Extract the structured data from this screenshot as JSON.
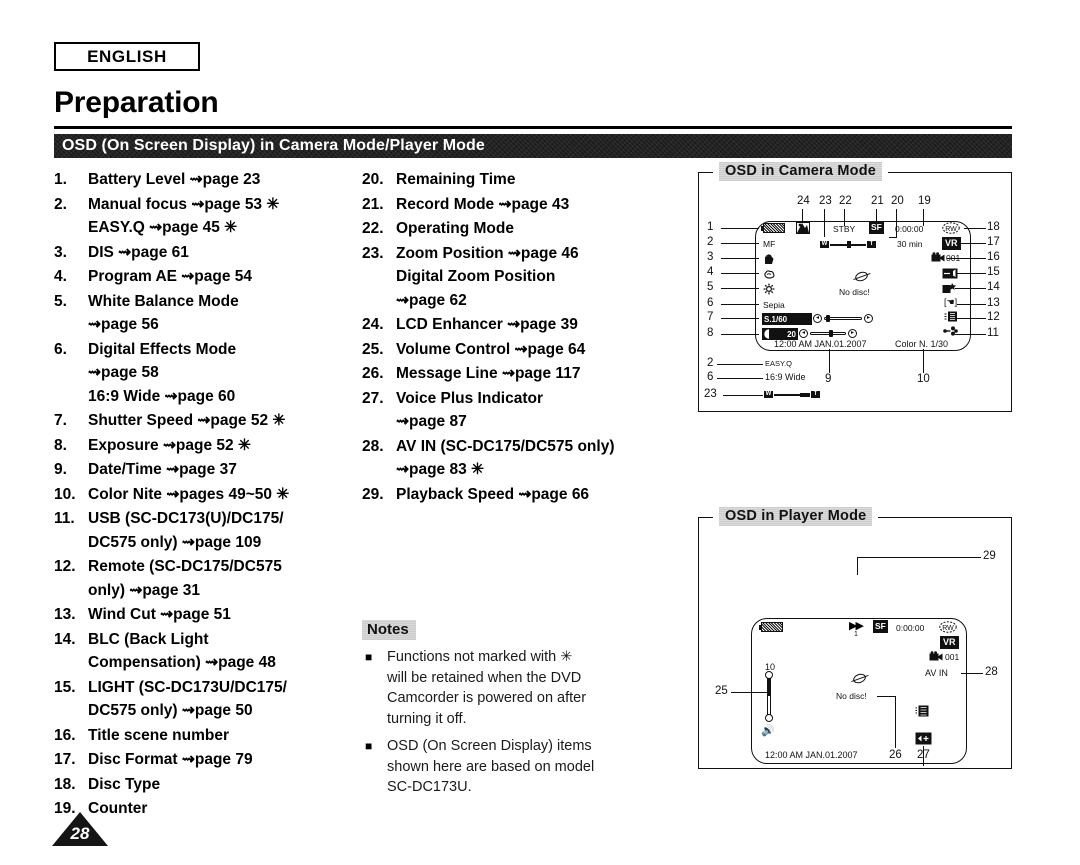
{
  "language_badge": "ENGLISH",
  "chapter_title": "Preparation",
  "section_header": "OSD (On Screen Display) in Camera Mode/Player Mode",
  "page_number": "28",
  "left_list": [
    {
      "num": "1.",
      "text": "Battery Level ⇝page 23"
    },
    {
      "num": "2.",
      "text": "Manual focus ⇝page 53  ✳\nEASY.Q ⇝page 45  ✳"
    },
    {
      "num": "3.",
      "text": "DIS ⇝page 61"
    },
    {
      "num": "4.",
      "text": "Program AE ⇝page 54"
    },
    {
      "num": "5.",
      "text": "White Balance Mode\n⇝page 56"
    },
    {
      "num": "6.",
      "text": "Digital Effects Mode\n⇝page 58\n16:9 Wide ⇝page 60"
    },
    {
      "num": "7.",
      "text": "Shutter Speed ⇝page 52  ✳"
    },
    {
      "num": "8.",
      "text": "Exposure ⇝page 52  ✳"
    },
    {
      "num": "9.",
      "text": "Date/Time ⇝page 37"
    },
    {
      "num": "10.",
      "text": "Color Nite ⇝pages 49~50  ✳"
    },
    {
      "num": "11.",
      "text": "USB (SC-DC173(U)/DC175/\nDC575 only) ⇝page 109"
    },
    {
      "num": "12.",
      "text": "Remote (SC-DC175/DC575\nonly) ⇝page 31"
    },
    {
      "num": "13.",
      "text": "Wind Cut ⇝page 51"
    },
    {
      "num": "14.",
      "text": "BLC (Back Light\nCompensation) ⇝page 48"
    },
    {
      "num": "15.",
      "text": "LIGHT (SC-DC173U/DC175/\nDC575 only) ⇝page 50"
    },
    {
      "num": "16.",
      "text": "Title scene number"
    },
    {
      "num": "17.",
      "text": "Disc Format ⇝page 79"
    },
    {
      "num": "18.",
      "text": "Disc Type"
    },
    {
      "num": "19.",
      "text": "Counter"
    }
  ],
  "mid_list": [
    {
      "num": "20.",
      "text": "Remaining Time"
    },
    {
      "num": "21.",
      "text": "Record Mode ⇝page 43"
    },
    {
      "num": "22.",
      "text": "Operating Mode"
    },
    {
      "num": "23.",
      "text": "Zoom Position ⇝page 46\nDigital Zoom Position\n⇝page 62"
    },
    {
      "num": "24.",
      "text": "LCD Enhancer ⇝page 39"
    },
    {
      "num": "25.",
      "text": "Volume Control ⇝page 64"
    },
    {
      "num": "26.",
      "text": "Message Line ⇝page 117"
    },
    {
      "num": "27.",
      "text": "Voice Plus Indicator\n⇝page 87"
    },
    {
      "num": "28.",
      "text": "AV IN (SC-DC175/DC575 only)\n⇝page 83  ✳"
    },
    {
      "num": "29.",
      "text": "Playback Speed ⇝page 66"
    }
  ],
  "notes": {
    "title": "Notes",
    "items": [
      "Functions not marked with  ✳\nwill be retained when the DVD\nCamcorder is powered on after\nturning it off.",
      "OSD (On Screen Display) items\nshown here are based on model\nSC-DC173U."
    ]
  },
  "camera_panel": {
    "legend": "OSD in Camera Mode",
    "top_callouts": [
      "24",
      "23",
      "22",
      "21",
      "20",
      "19"
    ],
    "left_callouts": [
      "1",
      "2",
      "3",
      "4",
      "5",
      "6",
      "7",
      "8"
    ],
    "right_callouts": [
      "18",
      "17",
      "16",
      "15",
      "14",
      "13",
      "12",
      "11"
    ],
    "below_callouts": [
      "2",
      "6",
      "23",
      "9",
      "10"
    ],
    "osd": {
      "operating_mode": "STBY",
      "record_mode": "SF",
      "counter": "0:00:00",
      "disc_type": "RW",
      "remaining_time": "30 min",
      "disc_format": "VR",
      "title_scene_number": "001",
      "manual_focus": "MF",
      "digital_effect": "Sepia",
      "shutter_speed": "S.1/60",
      "exposure": "20",
      "datetime": "12:00 AM JAN.01.2007",
      "color_nite": "Color N. 1/30",
      "no_disc_message": "No disc!",
      "easy_q": "EASY.Q",
      "wide_16_9": "16:9 Wide",
      "zoom_w": "W",
      "zoom_t": "T"
    }
  },
  "player_panel": {
    "legend": "OSD in Player Mode",
    "callouts": [
      "29",
      "28",
      "27",
      "26",
      "25"
    ],
    "osd": {
      "playback_speed_index": "1",
      "record_mode": "SF",
      "counter": "0:00:00",
      "disc_type": "RW",
      "disc_format": "VR",
      "title_scene_number": "001",
      "av_in": "AV IN",
      "volume_value": "10",
      "no_disc_message": "No disc!",
      "datetime": "12:00 AM JAN.01.2007"
    }
  }
}
